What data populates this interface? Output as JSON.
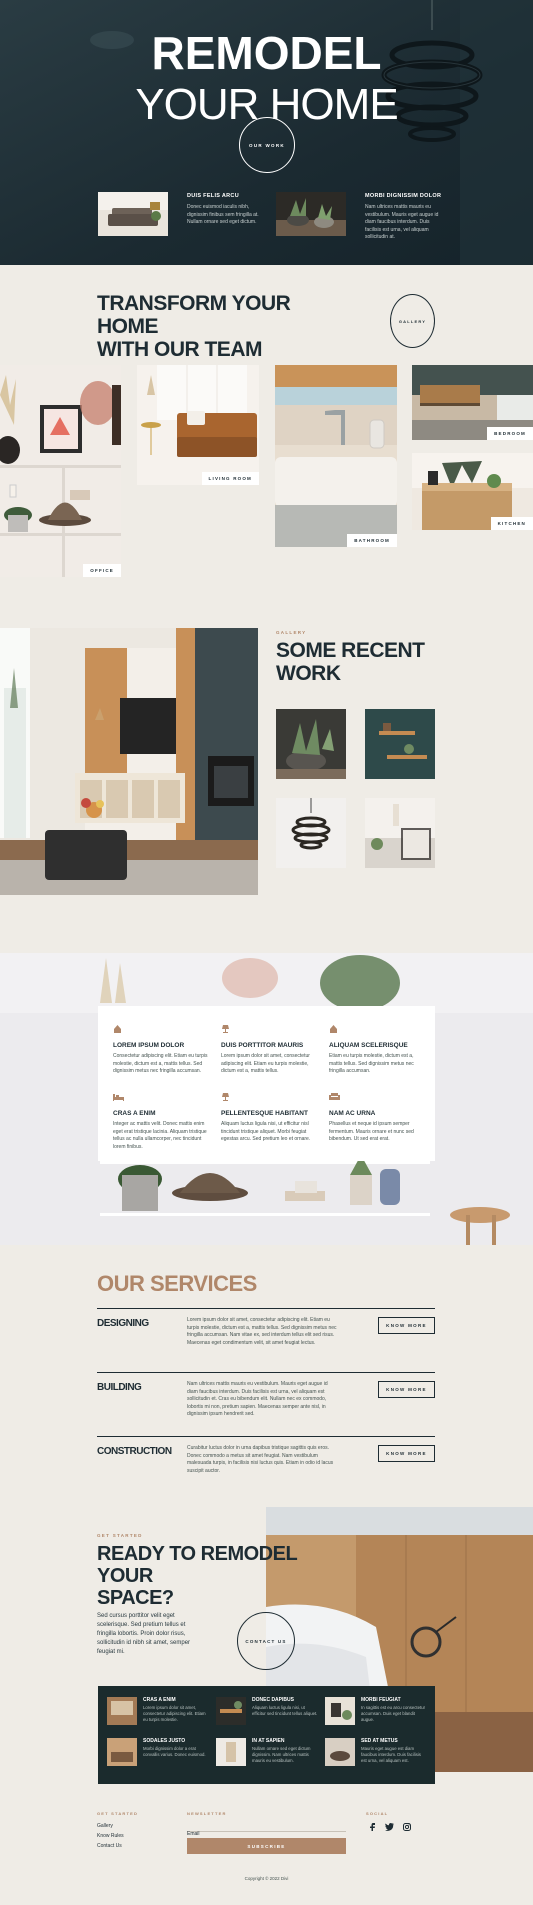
{
  "hero": {
    "title_line1": "REMODEL",
    "title_line2": "YOUR HOME",
    "cta": "OUR WORK",
    "features": [
      {
        "title": "DUIS FELIS ARCU",
        "text": "Donec euismod iaculis nibh, dignissim finibus sem fringilla at. Nullam ornare sed eget dictum."
      },
      {
        "title": "MORBI DIGNISSIM DOLOR",
        "text": "Nam ultrices mattis mauris eu vestibulum. Mauris eget augue id diam faucibus interdum. Duis facilisis est urna, vel aliquam sollicitudin at."
      }
    ]
  },
  "transform": {
    "heading_line1": "TRANSFORM YOUR HOME",
    "heading_line2": "WITH OUR TEAM",
    "gallery_btn": "GALLERY",
    "tags": {
      "office": "OFFICE",
      "living": "LIVING ROOM",
      "bathroom": "BATHROOM",
      "bedroom": "BEDROOM",
      "kitchen": "KITCHEN"
    }
  },
  "recent": {
    "eyebrow": "GALLERY",
    "heading_line1": "SOME RECENT",
    "heading_line2": "WORK"
  },
  "features_card": {
    "items": [
      {
        "icon": "house-icon",
        "title": "LOREM IPSUM DOLOR",
        "text": "Consectetur adipiscing elit. Etiam eu turpis molestie, dictum est a, mattis tellus. Sed dignissim metus nec fringilla accumsan."
      },
      {
        "icon": "lamp-icon",
        "title": "DUIS PORTTITOR MAURIS",
        "text": "Lorem ipsum dolor sit amet, consectetur adipiscing elit. Etiam eu turpis molestie, dictum est a, mattis tellus."
      },
      {
        "icon": "house-icon",
        "title": "ALIQUAM SCELERISQUE",
        "text": "Etiam eu turpis molestie, dictum est a, mattis tellus. Sed dignissim metus nec fringilla accumsan."
      },
      {
        "icon": "bed-icon",
        "title": "CRAS A ENIM",
        "text": "Integer ac mattis velit. Donec mattis enim eget erat tristique lacinia. Aliquam tristique tellus ac nulla ullamcorper, nec tincidunt lorem finibus."
      },
      {
        "icon": "lamp-icon",
        "title": "PELLENTESQUE HABITANT",
        "text": "Aliquam luctus ligula nisi, ut efficitur nisl tincidunt tristique aliquet. Morbi feugiat egestas arcu. Sed pretium leo et ornare."
      },
      {
        "icon": "sofa-icon",
        "title": "NAM AC URNA",
        "text": "Phasellus et neque id ipsum semper fermentum. Mauris ornare et nunc sed bibendum. Ut sed erat erat."
      }
    ]
  },
  "services": {
    "heading": "OUR SERVICES",
    "btn": "KNOW MORE",
    "items": [
      {
        "name": "DESIGNING",
        "text": "Lorem ipsum dolor sit amet, consectetur adipiscing elit. Etiam eu turpis molestie, dictum est a, mattis tellus. Sed dignissim metus nec fringilla accumsan. Nam vitae ex, sed interdum tellus elit sed risus. Maecenas eget condimentum velit, sit amet feugiat lectus."
      },
      {
        "name": "BUILDING",
        "text": "Nam ultrices mattis mauris eu vestibulum. Mauris eget augue id diam faucibus interdum. Duis facilisis est urna, vel aliquam est sollicitudin et. Cras eu bibendum elit. Nullam nec ex commodo, lobortis mi non, pretium sapien. Maecenas semper ante nisl, in dignissim ipsum hendrerit sed."
      },
      {
        "name": "CONSTRUCTION",
        "text": "Curabitur luctus dolor in urna dapibus tristique sagittis quis eros. Donec commodo a metus sit amet feugiat. Nam vestibulum malesuada turpis, in facilisis nisi luctus quis. Etiam in odio id lacus suscipit auctor."
      }
    ]
  },
  "ready": {
    "eyebrow": "GET STARTED",
    "heading_line1": "READY TO REMODEL YOUR",
    "heading_line2": "SPACE?",
    "text": "Sed cursus porttitor velit eget scelerisque. Sed pretium tellus et fringilla lobortis. Proin dolor risus, sollicitudin id nibh sit amet, semper feugiat mi.",
    "cta": "CONTACT US",
    "posts": [
      {
        "title": "CRAS A ENIM",
        "text": "Lorem ipsum dolor sit amet, consectetur adipiscing elit. Etiam eu turpis molestie."
      },
      {
        "title": "DONEC DAPIBUS",
        "text": "Aliquam luctus ligula nisi, ut efficitur sed tincidunt tellus aliquet."
      },
      {
        "title": "MORBI FEUGIAT",
        "text": "In sagittis est eu arcu consectetur accumsan. Duis eget blandit augue."
      },
      {
        "title": "SODALES JUSTO",
        "text": "Morbi dignissim dolor a erat convallis varius. Donec euismod."
      },
      {
        "title": "IN AT SAPIEN",
        "text": "Nullam ornare sed eget dictum dignissim. Nam ultrices mattis mauris eu vestibulum."
      },
      {
        "title": "SED AT METUS",
        "text": "Mauris eget augue est diam faucibus interdum. Duis facilisis est urna, vel aliquam est."
      }
    ]
  },
  "footer": {
    "col1_title": "GET STARTED",
    "links": [
      "Gallery",
      "Know Rules",
      "Contact Us"
    ],
    "col2_title": "NEWSLETTER",
    "email_label": "Email",
    "subscribe": "SUBSCRIBE",
    "col3_title": "SOCIAL",
    "copyright": "Copyright © 2022 Divi"
  },
  "colors": {
    "dark": "#1e2c33",
    "cream": "#efece6",
    "accent": "#b0876a"
  }
}
